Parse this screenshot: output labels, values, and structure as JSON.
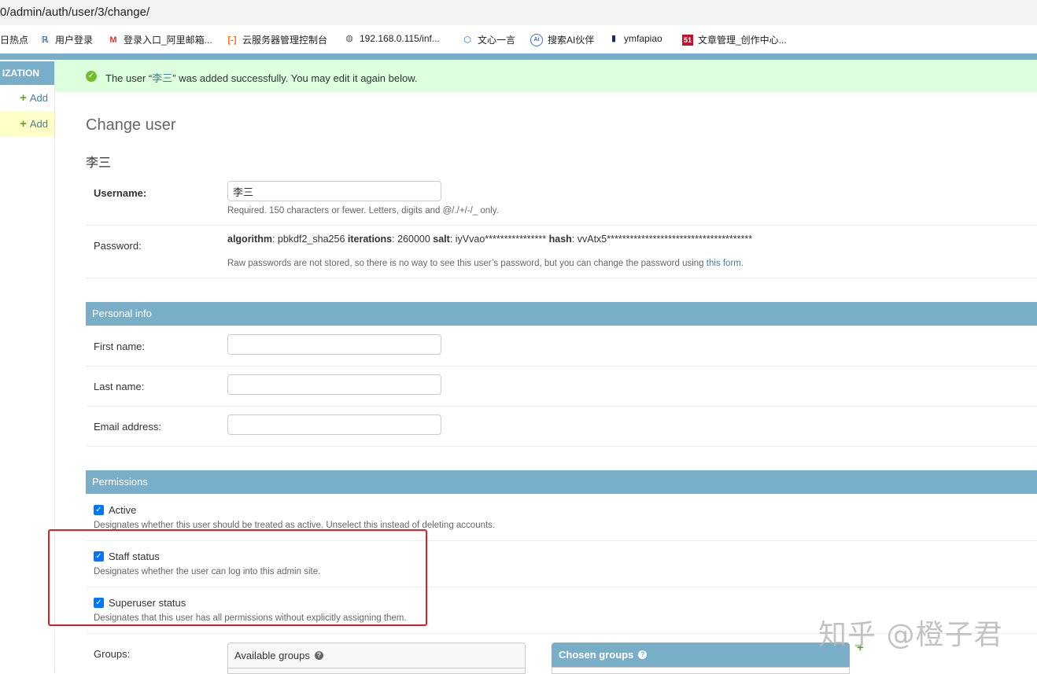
{
  "browser": {
    "url": "0/admin/auth/user/3/change/",
    "bookmarks": [
      {
        "label": "日热点",
        "icon": "none"
      },
      {
        "label": "用户登录",
        "icon": "r-logo-icon"
      },
      {
        "label": "登录入口_阿里邮箱...",
        "icon": "m-logo-icon"
      },
      {
        "label": "云服务器管理控制台",
        "icon": "aliyun-icon"
      },
      {
        "label": "192.168.0.115/inf...",
        "icon": "globe-icon"
      },
      {
        "label": "文心一言",
        "icon": "wenxin-icon"
      },
      {
        "label": "搜索AI伙伴",
        "icon": "ai-icon"
      },
      {
        "label": "ymfapiao",
        "icon": "doc-icon"
      },
      {
        "label": "文章管理_创作中心...",
        "icon": "51-icon"
      }
    ]
  },
  "sidebar": {
    "caption": "IZATION",
    "add_label": "Add"
  },
  "message": {
    "prefix": "The user “",
    "user": "李三",
    "suffix": "” was added successfully. You may edit it again below."
  },
  "page": {
    "title": "Change user",
    "object_name": "李三"
  },
  "fields": {
    "username": {
      "label": "Username:",
      "value": "李三",
      "help": "Required. 150 characters or fewer. Letters, digits and @/./+/-/_ only."
    },
    "password": {
      "label": "Password:",
      "algorithm_key": "algorithm",
      "algorithm_val": ": pbkdf2_sha256 ",
      "iterations_key": "iterations",
      "iterations_val": ": 260000 ",
      "salt_key": "salt",
      "salt_val": ": iyVvao**************** ",
      "hash_key": "hash",
      "hash_val": ": vvAtx5**************************************",
      "help": "Raw passwords are not stored, so there is no way to see this user’s password, but you can change the password using ",
      "help_link": "this form",
      "help_end": "."
    }
  },
  "personal_info": {
    "title": "Personal info",
    "first_name": {
      "label": "First name:",
      "value": ""
    },
    "last_name": {
      "label": "Last name:",
      "value": ""
    },
    "email": {
      "label": "Email address:",
      "value": ""
    }
  },
  "permissions": {
    "title": "Permissions",
    "active": {
      "label": "Active",
      "checked": true,
      "help": "Designates whether this user should be treated as active. Unselect this instead of deleting accounts."
    },
    "staff": {
      "label": "Staff status",
      "checked": true,
      "help": "Designates whether the user can log into this admin site."
    },
    "superuser": {
      "label": "Superuser status",
      "checked": true,
      "help": "Designates that this user has all permissions without explicitly assigning them."
    },
    "groups_label": "Groups:",
    "available_groups": "Available groups",
    "chosen_groups": "Chosen groups"
  },
  "watermark": "知乎 @橙子君",
  "colors": {
    "accent": "#79aec8",
    "success_bg": "#ddffdd",
    "highlight": "#e02020"
  }
}
